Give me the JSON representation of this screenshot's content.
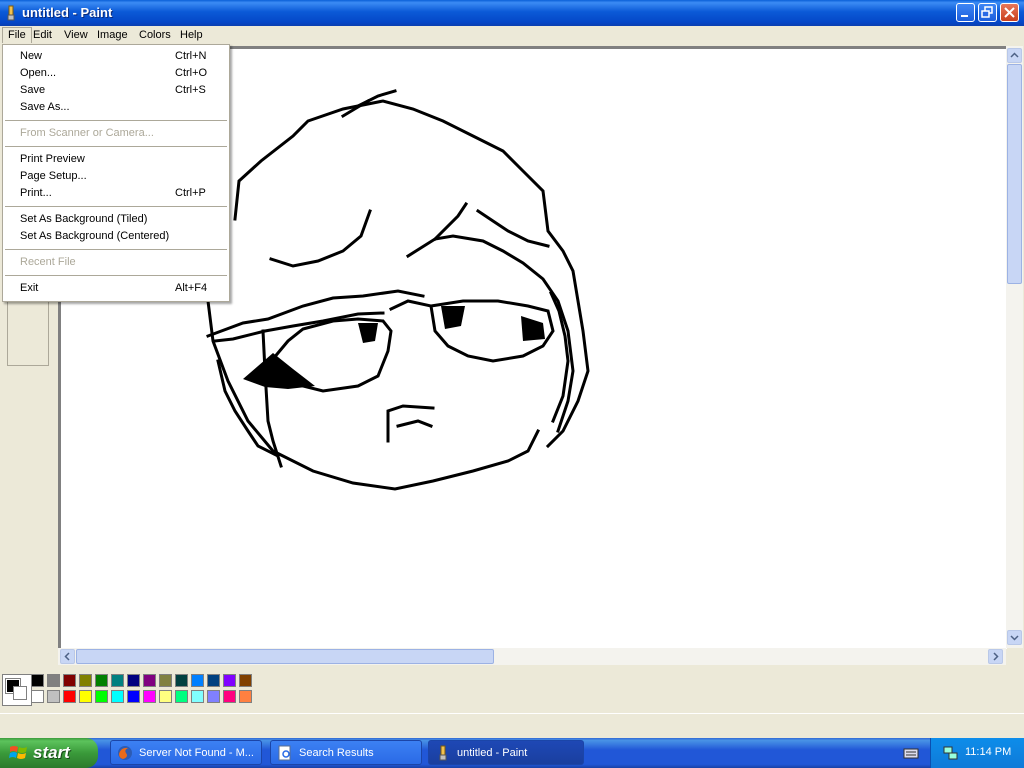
{
  "window": {
    "title": "untitled - Paint"
  },
  "menubar": [
    "File",
    "Edit",
    "View",
    "Image",
    "Colors",
    "Help"
  ],
  "file_menu": {
    "groups": [
      [
        {
          "label": "New",
          "shortcut": "Ctrl+N",
          "enabled": true
        },
        {
          "label": "Open...",
          "shortcut": "Ctrl+O",
          "enabled": true
        },
        {
          "label": "Save",
          "shortcut": "Ctrl+S",
          "enabled": true
        },
        {
          "label": "Save As...",
          "shortcut": "",
          "enabled": true
        }
      ],
      [
        {
          "label": "From Scanner or Camera...",
          "shortcut": "",
          "enabled": false
        }
      ],
      [
        {
          "label": "Print Preview",
          "shortcut": "",
          "enabled": true
        },
        {
          "label": "Page Setup...",
          "shortcut": "",
          "enabled": true
        },
        {
          "label": "Print...",
          "shortcut": "Ctrl+P",
          "enabled": true
        }
      ],
      [
        {
          "label": "Set As Background (Tiled)",
          "shortcut": "",
          "enabled": true
        },
        {
          "label": "Set As Background (Centered)",
          "shortcut": "",
          "enabled": true
        }
      ],
      [
        {
          "label": "Recent File",
          "shortcut": "",
          "enabled": false
        }
      ],
      [
        {
          "label": "Exit",
          "shortcut": "Alt+F4",
          "enabled": true
        }
      ]
    ]
  },
  "palette": {
    "foreground": "#000000",
    "background": "#ffffff",
    "row1": [
      "#000000",
      "#808080",
      "#800000",
      "#808000",
      "#008000",
      "#008080",
      "#000080",
      "#800080",
      "#808040",
      "#004040",
      "#0080ff",
      "#004080",
      "#8000ff",
      "#804000"
    ],
    "row2": [
      "#ffffff",
      "#c0c0c0",
      "#ff0000",
      "#ffff00",
      "#00ff00",
      "#00ffff",
      "#0000ff",
      "#ff00ff",
      "#ffff80",
      "#00ff80",
      "#80ffff",
      "#8080ff",
      "#ff0080",
      "#ff8040"
    ]
  },
  "taskbar": {
    "start_label": "start",
    "tasks": [
      {
        "label": "Server Not Found - M...",
        "icon": "firefox-icon",
        "active": false
      },
      {
        "label": "Search Results",
        "icon": "search-results-icon",
        "active": false
      },
      {
        "label": "untitled - Paint",
        "icon": "paint-icon",
        "active": true
      }
    ],
    "clock": "11:14 PM"
  }
}
